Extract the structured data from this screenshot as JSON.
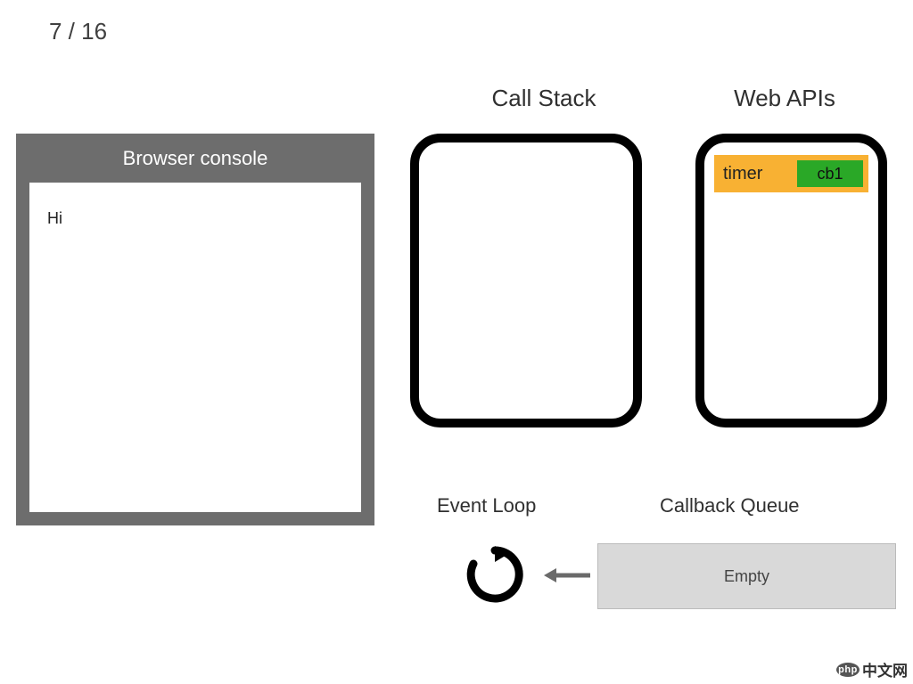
{
  "slide": {
    "counter": "7 / 16"
  },
  "console": {
    "title": "Browser console",
    "lines": [
      "Hi"
    ]
  },
  "headings": {
    "callstack": "Call Stack",
    "webapis": "Web APIs",
    "eventloop": "Event Loop",
    "callbackqueue": "Callback Queue"
  },
  "webapis": {
    "timer_label": "timer",
    "callback_label": "cb1"
  },
  "queue": {
    "content": "Empty"
  },
  "watermark": {
    "badge": "php",
    "text": "中文网"
  }
}
